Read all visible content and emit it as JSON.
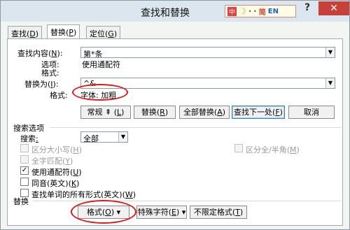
{
  "window": {
    "title": "查找和替换"
  },
  "ime": {
    "zh": "中",
    "sep": "• •",
    "label": "简",
    "en": "EN"
  },
  "controls": {
    "help": "?",
    "close": "✕"
  },
  "tabs": [
    {
      "label": "查找(",
      "key": "D",
      "close": ")"
    },
    {
      "label": "替换(",
      "key": "P",
      "close": ")"
    },
    {
      "label": "定位(",
      "key": "G",
      "close": ")"
    }
  ],
  "find": {
    "label": "查找内容(",
    "key": "N",
    "close": "):",
    "value": "第*条",
    "options_label": "选项:",
    "options_value": "使用通配符",
    "format_label": "格式:"
  },
  "replace": {
    "label": "替换为(",
    "key": "I",
    "close": "):",
    "value": "^&",
    "format_label": "格式:",
    "format_value": "字体: 加粗"
  },
  "buttons": {
    "less": {
      "pre": "常规 ",
      "arrow": "⇞",
      "post": " (",
      "key": "L",
      "close": ")"
    },
    "replace": {
      "pre": "替换(",
      "key": "R",
      "close": ")"
    },
    "replace_all": {
      "pre": "全部替换(",
      "key": "A",
      "close": ")"
    },
    "find_next": {
      "pre": "查找下一处(",
      "key": "F",
      "close": ")"
    },
    "cancel": "取消"
  },
  "search_options": {
    "section": "搜索选项",
    "search_label": "搜索",
    "search_colon": ":",
    "search_value": "全部",
    "checkboxes": [
      {
        "pre": "区分大小写(",
        "key": "H",
        "close": ")",
        "checked": false,
        "disabled": true
      },
      {
        "pre": "全字匹配(",
        "key": "Y",
        "close": ")",
        "checked": false,
        "disabled": true
      },
      {
        "pre": "使用通配符(",
        "key": "U",
        "close": ")",
        "checked": true,
        "disabled": false
      },
      {
        "pre": "同音(英文)(",
        "key": "K",
        "close": ")",
        "checked": false,
        "disabled": false
      },
      {
        "pre": "查找单词的所有形式(英文)(",
        "key": "W",
        "close": ")",
        "checked": false,
        "disabled": false
      }
    ],
    "fullwidth": {
      "pre": "区分全/半角(",
      "key": "M",
      "close": ")"
    }
  },
  "replace_section": {
    "section": "替换",
    "format_btn": {
      "pre": "格式(",
      "key": "O",
      "close": ") ▾"
    },
    "special_btn": {
      "pre": "特殊字符(",
      "key": "E",
      "close": ") ▾"
    },
    "no_format_btn": {
      "pre": "不限定格式(",
      "key": "T",
      "close": ")"
    }
  },
  "colors": {
    "annotation": "#e01818",
    "title_bar": "#dbe6ee",
    "close": "#c7413a"
  }
}
